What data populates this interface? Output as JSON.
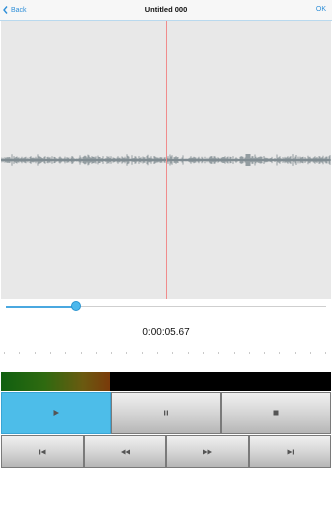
{
  "nav": {
    "back_label": "Back",
    "title": "Untitled 000",
    "ok_label": "OK",
    "accent_color": "#2f8fd8"
  },
  "playback": {
    "position_fraction": 0.22,
    "time": "0:00:05.67"
  },
  "level_meter": {
    "level_fraction": 0.33
  },
  "transport": {
    "buttons": [
      {
        "name": "play",
        "icon": "play-icon",
        "active": true
      },
      {
        "name": "pause",
        "icon": "pause-icon",
        "active": false
      },
      {
        "name": "stop",
        "icon": "stop-icon",
        "active": false
      },
      {
        "name": "skip-to-start",
        "icon": "skip-back-icon",
        "active": false
      },
      {
        "name": "rewind",
        "icon": "rewind-icon",
        "active": false
      },
      {
        "name": "fast-forward",
        "icon": "fast-forward-icon",
        "active": false
      },
      {
        "name": "skip-to-end",
        "icon": "skip-forward-icon",
        "active": false
      }
    ],
    "active_color": "#4dbde9"
  }
}
